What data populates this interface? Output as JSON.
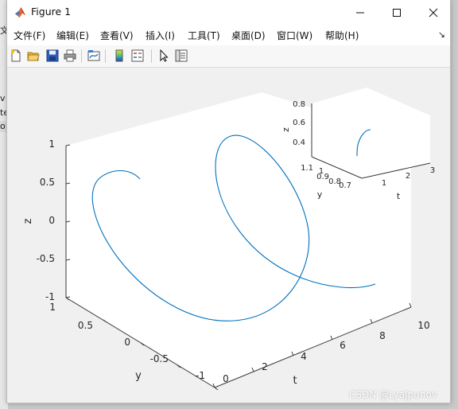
{
  "background": {
    "fragments": [
      "文",
      "v",
      "te",
      "o"
    ]
  },
  "window": {
    "title": "Figure 1",
    "icon": "matlab-logo-icon",
    "controls": [
      "minimize-icon",
      "maximize-icon",
      "close-icon"
    ]
  },
  "menu": {
    "items": [
      "文件(F)",
      "编辑(E)",
      "查看(V)",
      "插入(I)",
      "工具(T)",
      "桌面(D)",
      "窗口(W)",
      "帮助(H)"
    ],
    "overflow_icon": "chevron-icon"
  },
  "toolbar": {
    "icons": [
      "new-figure-icon",
      "open-file-icon",
      "save-icon",
      "print-icon",
      "link-plot-icon",
      "colorbar-icon",
      "legend-icon",
      "edit-plot-cursor-icon",
      "property-inspector-icon"
    ]
  },
  "plot": {
    "line_color": "#0072bd",
    "main_axes": {
      "xlabel": "t",
      "ylabel": "y",
      "zlabel": "z",
      "x_ticks": [
        "0",
        "2",
        "4",
        "6",
        "8",
        "10"
      ],
      "y_ticks": [
        "1",
        "0.5",
        "0",
        "-0.5",
        "-1"
      ],
      "z_ticks": [
        "1",
        "0.5",
        "0",
        "-0.5",
        "-1"
      ],
      "xlim": [
        0,
        10
      ],
      "ylim": [
        -1,
        1
      ],
      "zlim": [
        -1,
        1
      ]
    },
    "inset_axes": {
      "xlabel": "t",
      "ylabel": "y",
      "zlabel": "z",
      "x_ticks": [
        "1",
        "2",
        "3"
      ],
      "y_ticks": [
        "1.1",
        "1",
        "0.9",
        "0.8",
        "0.7"
      ],
      "z_ticks": [
        "0.8",
        "0.6",
        "0.4"
      ]
    }
  },
  "watermark": "CSDN @LyaJpunov"
}
